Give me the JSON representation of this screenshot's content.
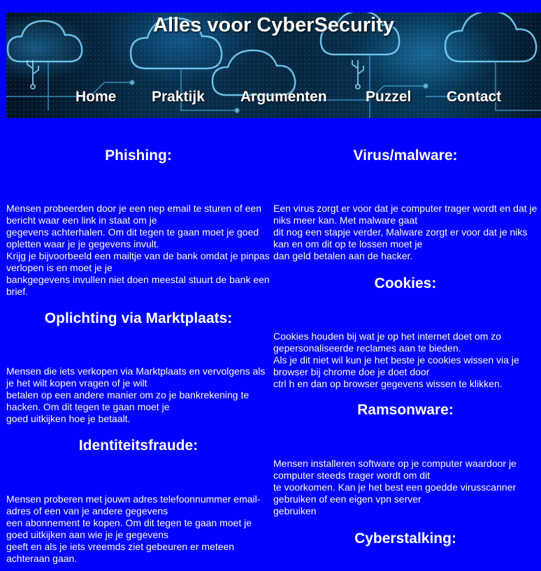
{
  "site": {
    "title": "Alles voor CyberSecurity"
  },
  "nav": {
    "items": [
      "Home",
      "Praktijk",
      "Argumenten",
      "Puzzel",
      "Contact"
    ]
  },
  "left": [
    {
      "heading": "Phishing:",
      "text": "Mensen probeerden door je een nep email te sturen of een bericht waar een link in staat om je\ngegevens achterhalen. Om dit tegen te gaan moet je goed opletten waar je je gegevens invult.\nKrijg je bijvoorbeeld een mailtje van de bank omdat je pinpas verlopen is en moet je je\nbankgegevens invullen niet doen meestal stuurt de bank een brief."
    },
    {
      "heading": "Oplichting via Marktplaats:",
      "text": "Mensen die iets verkopen via Marktplaats en vervolgens als je het wilt kopen vragen of je wilt\nbetalen op een andere manier om zo je bankrekening te hacken. Om dit tegen te gaan moet je\ngoed uitkijken hoe je betaalt."
    },
    {
      "heading": "Identiteitsfraude:",
      "text": "Mensen proberen met jouwn adres telefoonnummer email-adres of een van je andere gegevens\neen abonnement te kopen. Om dit tegen te gaan moet je goed uitkijken aan wie je je gegevens\ngeeft en als je iets vreemds ziet gebeuren er meteen achteraan gaan."
    }
  ],
  "right": [
    {
      "heading": "Virus/malware:",
      "text": "Een virus zorgt er voor dat je computer trager wordt en dat je niks meer kan. Met malware gaat\ndit nog een stapje verder, Malware zorgt er voor dat je niks kan en om dit op te lossen moet je\ndan geld betalen aan de hacker."
    },
    {
      "heading": "Cookies:",
      "text": "Cookies houden bij wat je op het internet doet om zo gepersonaliseerde reclames aan te bieden.\nAls je dit niet wil kun je het beste je cookies wissen via je browser bij chrome doe je doet door\nctrl h en dan op browser gegevens wissen te klikken."
    },
    {
      "heading": "Ramsonware:",
      "text": "Mensen installeren software op je computer waardoor je computer steeds trager wordt om dit\nte voorkomen. Kan je het best een goedde virusscanner gebruiken of een eigen vpn server\ngebruiken"
    },
    {
      "heading": "Cyberstalking:",
      "text": ""
    }
  ],
  "colors": {
    "page_background": "#0000fe",
    "text": "#ffffff"
  },
  "icons": [
    "cloud-icon",
    "usb-icon"
  ]
}
